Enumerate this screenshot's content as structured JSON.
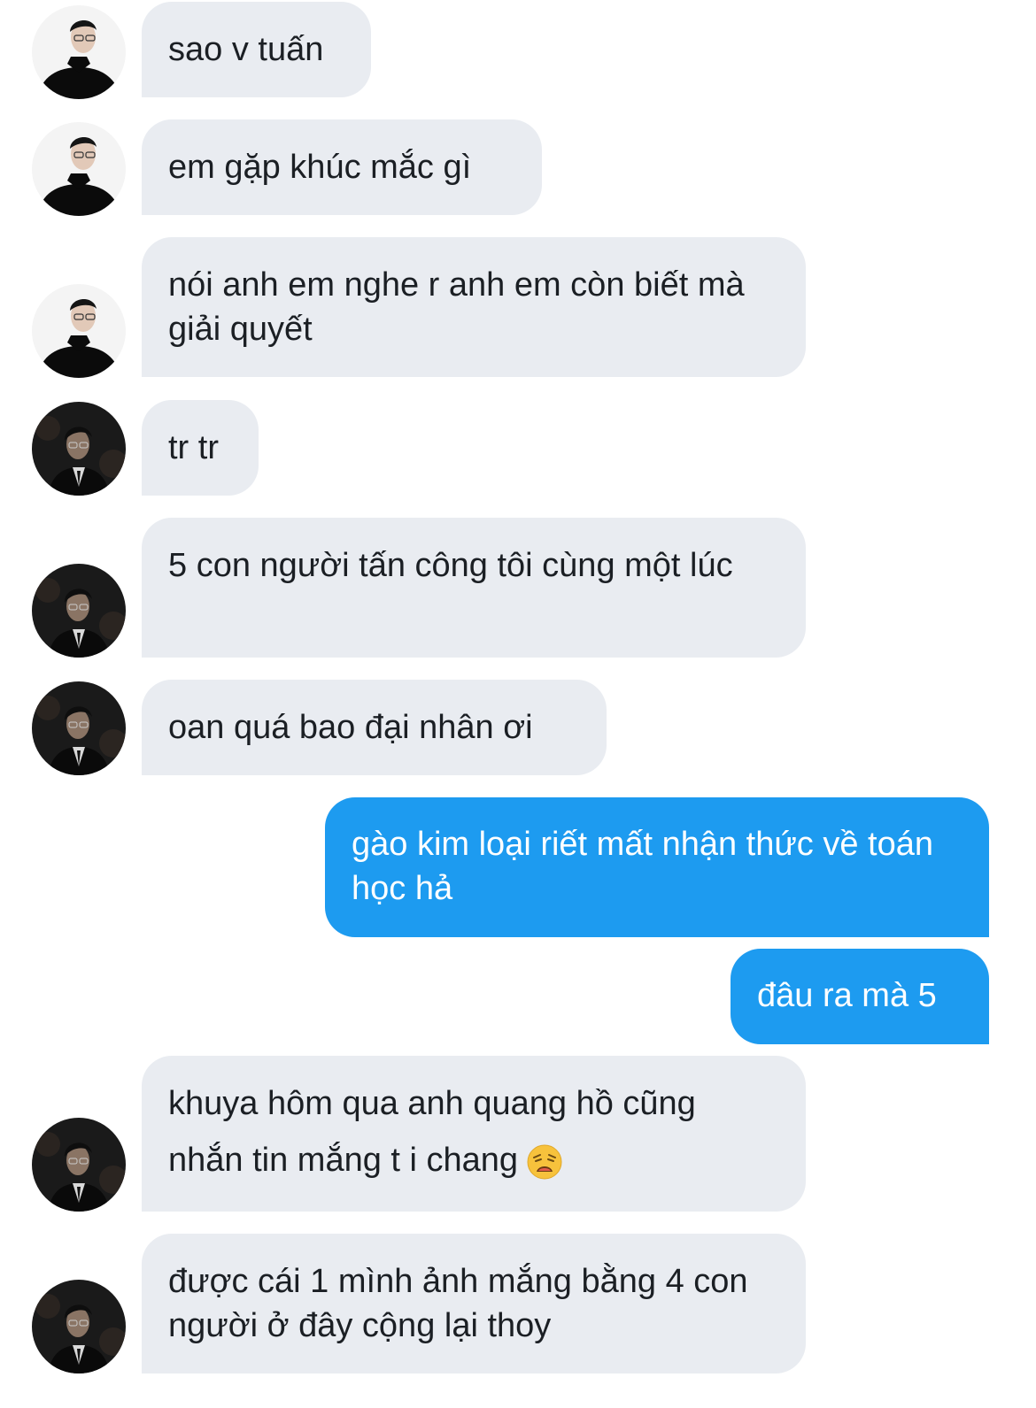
{
  "conversation": {
    "messages": [
      {
        "sender": "other",
        "text": "sao v tuấn"
      },
      {
        "sender": "other",
        "text": "em gặp khúc mắc gì"
      },
      {
        "sender": "other",
        "text": "nói anh em nghe r anh em còn biết mà giải quyết"
      },
      {
        "sender": "other",
        "text": "tr tr"
      },
      {
        "sender": "other",
        "text": "5 con người tấn công tôi cùng một lúc"
      },
      {
        "sender": "other",
        "text": "oan quá bao đại nhân ơi"
      },
      {
        "sender": "me",
        "text": "gào kim loại riết mất nhận thức về toán học hả"
      },
      {
        "sender": "me",
        "text": "đâu ra mà 5"
      },
      {
        "sender": "other",
        "text": "khuya hôm qua anh quang hồ cũng nhắn tin mắng t i chang",
        "emoji": "weary-face-emoji"
      },
      {
        "sender": "other",
        "text": "được cái 1 mình ảnh mắng bằng 4 con người ở đây cộng lại thoy"
      }
    ]
  },
  "colors": {
    "incoming_bubble": "#e9ecf1",
    "outgoing_bubble": "#1d9bf0",
    "incoming_text": "#1b1f24",
    "outgoing_text": "#ffffff"
  }
}
